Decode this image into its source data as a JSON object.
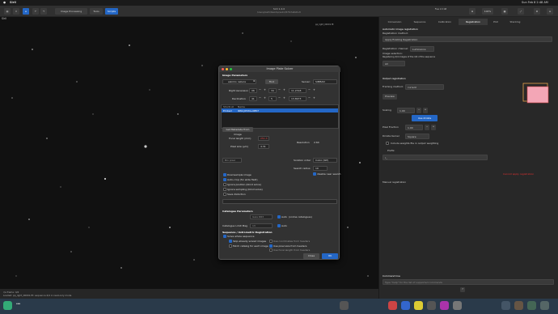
{
  "menubar": {
    "app": "Siril",
    "right_clock": "Sun Feb 8  2:48 AM"
  },
  "toolbar": {
    "image_processing": "Image Processing",
    "tools": "Tools",
    "scripts": "Scripts",
    "title": "Siril 1.4.0",
    "subtitle": "/Users/pbatti/Desktop/astro/M78-HaRGB-2h",
    "right_info": "Free 2.0 GB",
    "zoom": "100%"
  },
  "image_tab": {
    "label": "Siril",
    "filename": "pp_light_00001.fit"
  },
  "bottom_status": {
    "line1": "r/a  frame: 4/4",
    "line2": "Loaded: pp_light_00001.fit: sequence 4/4 in read-only mode"
  },
  "right_panel": {
    "tabs": [
      "Conversion",
      "Sequence",
      "Calibration",
      "Registration",
      "Plot",
      "Stacking"
    ],
    "active_tab": "Registration",
    "auto_reg_label": "Automatic image registration",
    "reg_method_label": "Registration method:",
    "reg_method_value": "Apply Existing Registration",
    "reg_channel_label": "Registration channel:",
    "reg_channel_value": "Luminance",
    "image_selection_label": "Image selection:",
    "image_selection_desc": "Registering 4/4 images of the 4/4 of the sequence",
    "selection_value": "All",
    "output_label": "Output registration",
    "framing_label": "Framing method:",
    "framing_value": "current",
    "preview_btn": "Preview",
    "scaling_label": "Scaling",
    "scaling_value": "1.00",
    "drizzle_btn": "Use drizzle",
    "pixel_fraction_label": "Pixel Fraction",
    "pixel_fraction_value": "1.00",
    "kernel_label": "Drizzle Kernel",
    "kernel_value": "Square",
    "include_label": "Include weights file in output weighting",
    "prefix_label": "Prefix:",
    "prefix_value": "r_",
    "warning": "Cannot apply registration",
    "manual_reg": "Manual registration",
    "command_line_label": "Command line",
    "command_placeholder": "Type \"help\" for the list of supported commands"
  },
  "dialog": {
    "title": "Image Plate Solver",
    "image_params": "Image Parameters",
    "search_placeholder": "eskimo nebula",
    "find_label": "Find",
    "server_label": "Server:",
    "server_value": "SIMBAD",
    "ra_label": "Right Ascension",
    "ra_h": "06",
    "ra_m": "34",
    "ra_s": "11.2318",
    "dec_label": "Declination",
    "dec_d": "41",
    "dec_m": "5",
    "dec_s": "13.8973",
    "results_col1": "Shortcut",
    "results_col2": "Name",
    "results_row_short": "Embed",
    "results_row_name": "IPAS J0534+0857",
    "get_metadata_btn": "Get Metadata From Image",
    "focal_label": "Focal length (mm)",
    "focal_value": "251.3",
    "pixel_label": "Pixel size (µm)",
    "pixel_value": "4.31",
    "resolution_label": "Resolution",
    "resolution_value": "2.64",
    "bin_label": "Bin pixel",
    "solution_order_label": "Solution order",
    "solution_order_value": "Cubic (SIP)",
    "search_radius_label": "Search radius",
    "search_radius_value": "10",
    "disable_near_label": "disable near search",
    "downsample_label": "Downsample image",
    "autocrop_label": "Auto-crop (for wide field)",
    "ignore_pos_label": "Ignore position (blind solve)",
    "ignore_sampling_label": "Ignore sampling (blind solve)",
    "save_label": "Save distortion",
    "catalogue_params": "Catalogue Parameters",
    "catalogue_value": "Gaia DR3",
    "auto_label": "Auto",
    "online_label": "(online catalogues)",
    "limit_mag_label": "Catalogue Limit Mag",
    "limit_mag_value": "13",
    "sequence_section": "Sequence / Astrometric Registration",
    "solve_whole_label": "Solve whole sequence",
    "skip_solved_label": "Skip already solved images",
    "fetch_catalog_label": "Fetch catalog for each image",
    "use_coords_label": "Use coordinates from headers",
    "use_pixel_label": "Use pixel size from headers",
    "use_focal_label": "Use focal length from headers",
    "close_btn": "Close",
    "ok_btn": "OK"
  }
}
